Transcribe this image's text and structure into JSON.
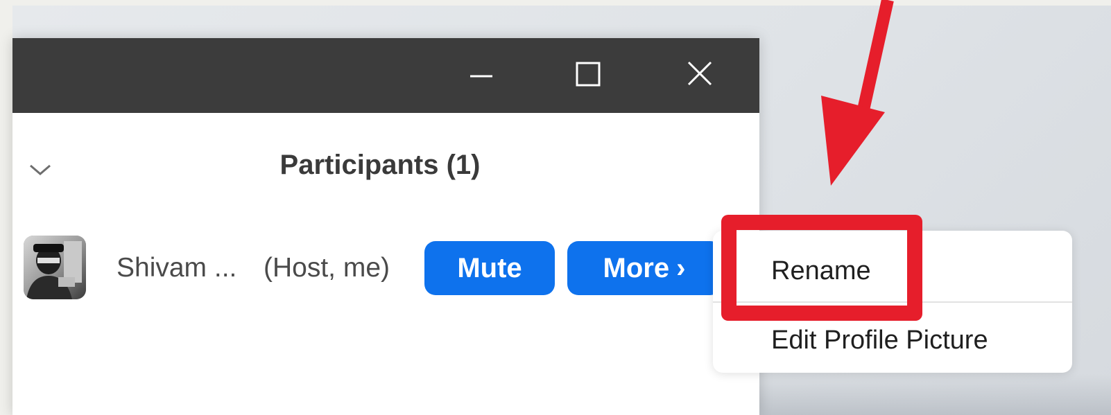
{
  "window": {
    "controls": {
      "minimize": "minimize-icon",
      "maximize": "maximize-icon",
      "close": "close-icon"
    }
  },
  "panel": {
    "title": "Participants (1)",
    "collapse_icon": "chevron-down-icon"
  },
  "participant": {
    "name": "Shivam ...",
    "role": "(Host, me)",
    "mute_label": "Mute",
    "more_label": "More",
    "more_chevron": "›"
  },
  "menu": {
    "items": [
      {
        "label": "Rename"
      },
      {
        "label": "Edit Profile Picture"
      }
    ]
  },
  "annotation": {
    "highlight_color": "#e61e2b",
    "arrow_color": "#e61e2b"
  },
  "colors": {
    "titlebar": "#3c3c3c",
    "accent": "#0e72ed"
  }
}
